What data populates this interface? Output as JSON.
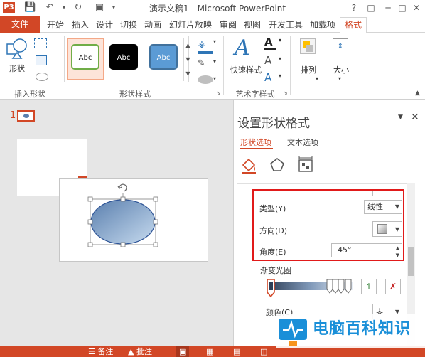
{
  "window": {
    "title": "演示文稿1 - Microsoft PowerPoint",
    "app_badge": "P3",
    "controls": [
      "?",
      "─",
      "□",
      "✕"
    ]
  },
  "tabs": [
    {
      "label": "文件",
      "type": "file"
    },
    {
      "label": "开始"
    },
    {
      "label": "插入"
    },
    {
      "label": "设计"
    },
    {
      "label": "切换"
    },
    {
      "label": "动画"
    },
    {
      "label": "幻灯片放映"
    },
    {
      "label": "审阅"
    },
    {
      "label": "视图"
    },
    {
      "label": "开发工具"
    },
    {
      "label": "加载项"
    },
    {
      "label": "格式",
      "active": true
    }
  ],
  "ribbon": {
    "insert_shapes": {
      "shapes_label": "形状",
      "group_label": "插入形状"
    },
    "shape_styles": {
      "samples": [
        {
          "label": "Abc",
          "fill": "#ffffff",
          "border": "#70ad47",
          "text": "#222222"
        },
        {
          "label": "Abc",
          "fill": "#000000",
          "border": "#000000",
          "text": "#ffffff"
        },
        {
          "label": "Abc",
          "fill": "#5b9bd5",
          "border": "#41719c",
          "text": "#ffffff"
        }
      ],
      "group_label": "形状样式"
    },
    "wordart": {
      "quick_styles_label": "快速样式",
      "group_label": "艺术字样式"
    },
    "arrange": {
      "label": "排列"
    },
    "size": {
      "label": "大小"
    }
  },
  "slides": {
    "number": "1"
  },
  "format_pane": {
    "title": "设置形状格式",
    "tabs": [
      {
        "label": "形状选项",
        "active": true
      },
      {
        "label": "文本选项"
      }
    ],
    "type_label": "类型(Y)",
    "type_value": "线性",
    "direction_label": "方向(D)",
    "angle_label": "角度(E)",
    "angle_value": "45°",
    "gradient_stops_label": "渐变光圈",
    "color_label": "颜色(C)"
  },
  "statusbar": {
    "notes": "备注",
    "comments": "批注"
  },
  "watermark": {
    "brand": "电脑百科知识",
    "url": "www.pc-daily.com"
  },
  "colors": {
    "accent": "#d24726",
    "highlight": "#e11a1a",
    "shape_fill_start": "#5a7fae",
    "shape_fill_end": "#c7dbef"
  }
}
